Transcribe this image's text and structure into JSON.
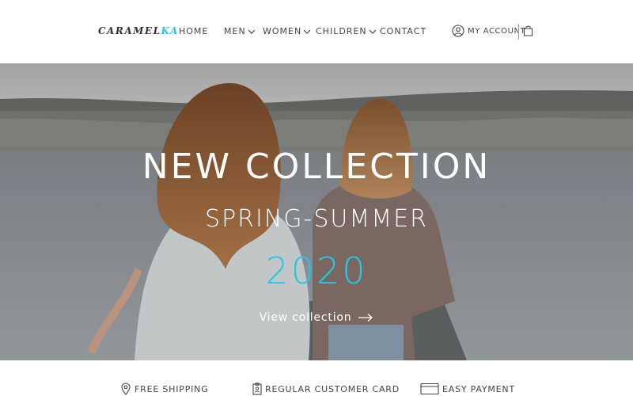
{
  "brand": {
    "logo_main": "CARAMEL",
    "logo_accent": "KA",
    "accent_color": "#29c6df"
  },
  "nav": [
    {
      "label": "HOME",
      "dropdown": false
    },
    {
      "label": "MEN",
      "dropdown": true
    },
    {
      "label": "WOMEN",
      "dropdown": true
    },
    {
      "label": "CHILDREN",
      "dropdown": true
    },
    {
      "label": "CONTACT",
      "dropdown": false
    }
  ],
  "header": {
    "account_label": "MY ACCOUNT",
    "icons": [
      "user-icon",
      "shopping-bag-icon"
    ]
  },
  "hero": {
    "title": "NEW COLLECTION",
    "subtitle": "SPRING-SUMMER",
    "year": "2020",
    "cta_label": "View collection",
    "cta_icon": "arrow-right-icon"
  },
  "features": [
    {
      "label": "FREE SHIPPING",
      "icon": "location-pin-icon"
    },
    {
      "label": "REGULAR CUSTOMER CARD",
      "icon": "badge-card-icon"
    },
    {
      "label": "EASY PAYMENT",
      "icon": "credit-card-icon"
    }
  ]
}
